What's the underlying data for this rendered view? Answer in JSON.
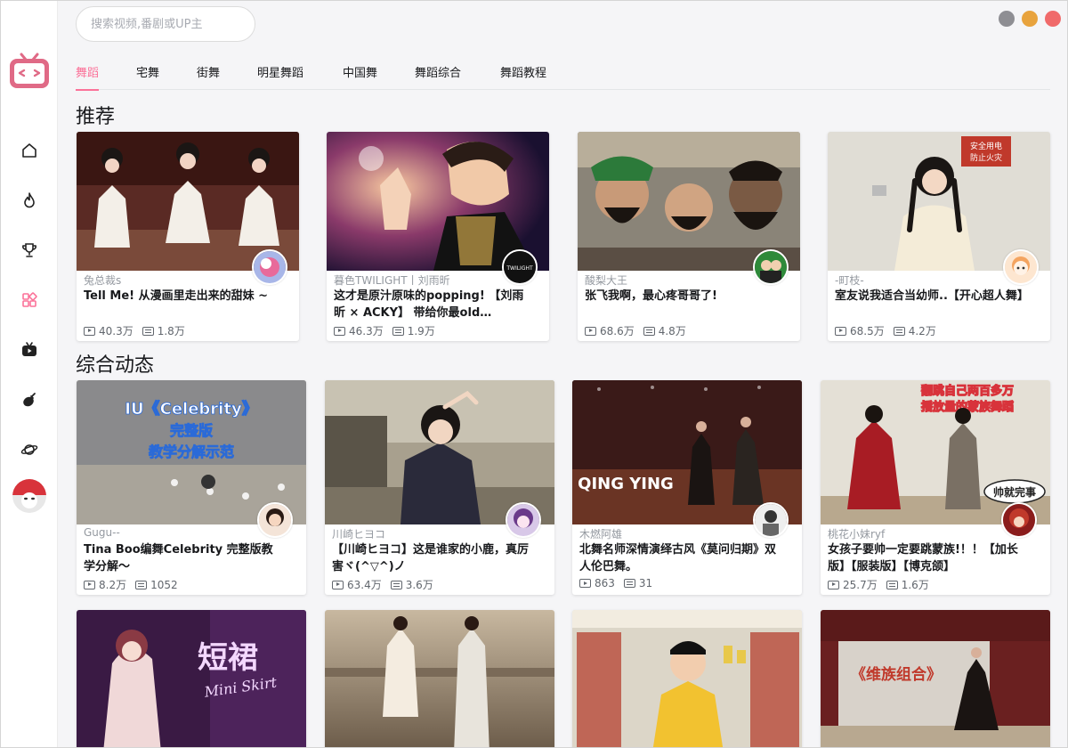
{
  "search": {
    "placeholder": "搜索视频,番剧或UP主"
  },
  "colors": {
    "accent": "#fb7299",
    "window_min": "#8e8e93",
    "window_max": "#e8a33d",
    "window_close": "#f06a6a"
  },
  "sidebar": {
    "items": [
      {
        "icon": "home-icon"
      },
      {
        "icon": "flame-icon"
      },
      {
        "icon": "trophy-icon"
      },
      {
        "icon": "grid-icon",
        "active": true
      },
      {
        "icon": "tv-icon"
      },
      {
        "icon": "eggplant-icon"
      },
      {
        "icon": "planet-icon"
      }
    ]
  },
  "tabs": [
    "舞蹈",
    "宅舞",
    "街舞",
    "明星舞蹈",
    "中国舞",
    "舞蹈综合",
    "舞蹈教程"
  ],
  "sections": {
    "recommended": "推荐",
    "dynamic": "综合动态"
  },
  "recommended": [
    {
      "uploader": "兔总裁s",
      "title": "Tell Me!  从漫画里走出来的甜妹 ~",
      "plays": "40.3万",
      "danmaku": "1.8万"
    },
    {
      "uploader": "暮色TWILIGHT丨刘雨昕",
      "title": "这才是原汁原味的popping! 【刘雨昕 × ACKY】 带给你最old school...",
      "plays": "46.3万",
      "danmaku": "1.9万"
    },
    {
      "uploader": "酸梨大王",
      "title": "张飞我啊，最心疼哥哥了!",
      "plays": "68.6万",
      "danmaku": "4.8万"
    },
    {
      "uploader": "-町枝-",
      "title": "室友说我适合当幼师..【开心超人舞】",
      "plays": "68.5万",
      "danmaku": "4.2万"
    }
  ],
  "dynamic": [
    {
      "uploader": "Gugu--",
      "title": "Tina Boo编舞Celebrity 完整版教学分解～",
      "plays": "8.2万",
      "danmaku": "1052"
    },
    {
      "uploader": "川崎ヒヨコ",
      "title": "【川崎ヒヨコ】这是谁家的小鹿，真厉害ヾ(^▽^)ノ",
      "plays": "63.4万",
      "danmaku": "3.6万"
    },
    {
      "uploader": "木燃阿雄",
      "title": "北舞名师深情演绎古风《莫问归期》双人伦巴舞。",
      "plays": "863",
      "danmaku": "31"
    },
    {
      "uploader": "桃花小妹ryf",
      "title": "女孩子要帅一定要跳蒙族!！！【加长版】【服装版】【博克颌】",
      "plays": "25.7万",
      "danmaku": "1.6万"
    }
  ],
  "thumb_text": {
    "celebrity": [
      "IU《Celebrity》",
      "完整版",
      "教学分解示范"
    ],
    "twilight": "TWILIGHT",
    "qingying": "QING YING",
    "mongol": [
      "翻跳自己两百多万",
      "播放量的蒙族舞蹈"
    ],
    "mongol_sticker": "帅就完事",
    "skirt": [
      "短裙",
      "Mini Skirt"
    ],
    "uyghur": "《维族组合》",
    "safety_sign": [
      "安全用电",
      "防止火灾"
    ]
  }
}
